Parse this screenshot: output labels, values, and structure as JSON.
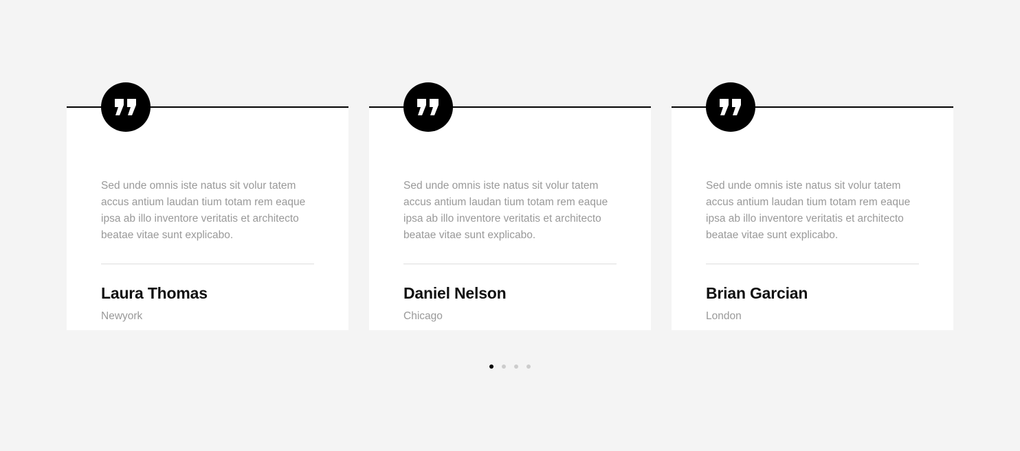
{
  "testimonials": [
    {
      "quote": "Sed unde omnis iste natus sit volur tatem accus antium laudan tium totam rem eaque ipsa ab illo inventore veritatis et architecto beatae vitae sunt explicabo.",
      "name": "Laura Thomas",
      "city": "Newyork",
      "icon": "quote-icon"
    },
    {
      "quote": "Sed unde omnis iste natus sit volur tatem accus antium laudan tium totam rem eaque ipsa ab illo inventore veritatis et architecto beatae vitae sunt explicabo.",
      "name": "Daniel Nelson",
      "city": "Chicago",
      "icon": "quote-icon"
    },
    {
      "quote": "Sed unde omnis iste natus sit volur tatem accus antium laudan tium totam rem eaque ipsa ab illo inventore veritatis et architecto beatae vitae sunt explicabo.",
      "name": "Brian Garcian",
      "city": "London",
      "icon": "quote-icon"
    }
  ],
  "pagination": {
    "count": 4,
    "active_index": 0
  },
  "colors": {
    "background": "#f4f4f4",
    "card": "#ffffff",
    "accent": "#000000",
    "muted_text": "#999999",
    "heading_text": "#111111",
    "divider": "#dddddd",
    "inactive_dot": "#cccccc"
  }
}
